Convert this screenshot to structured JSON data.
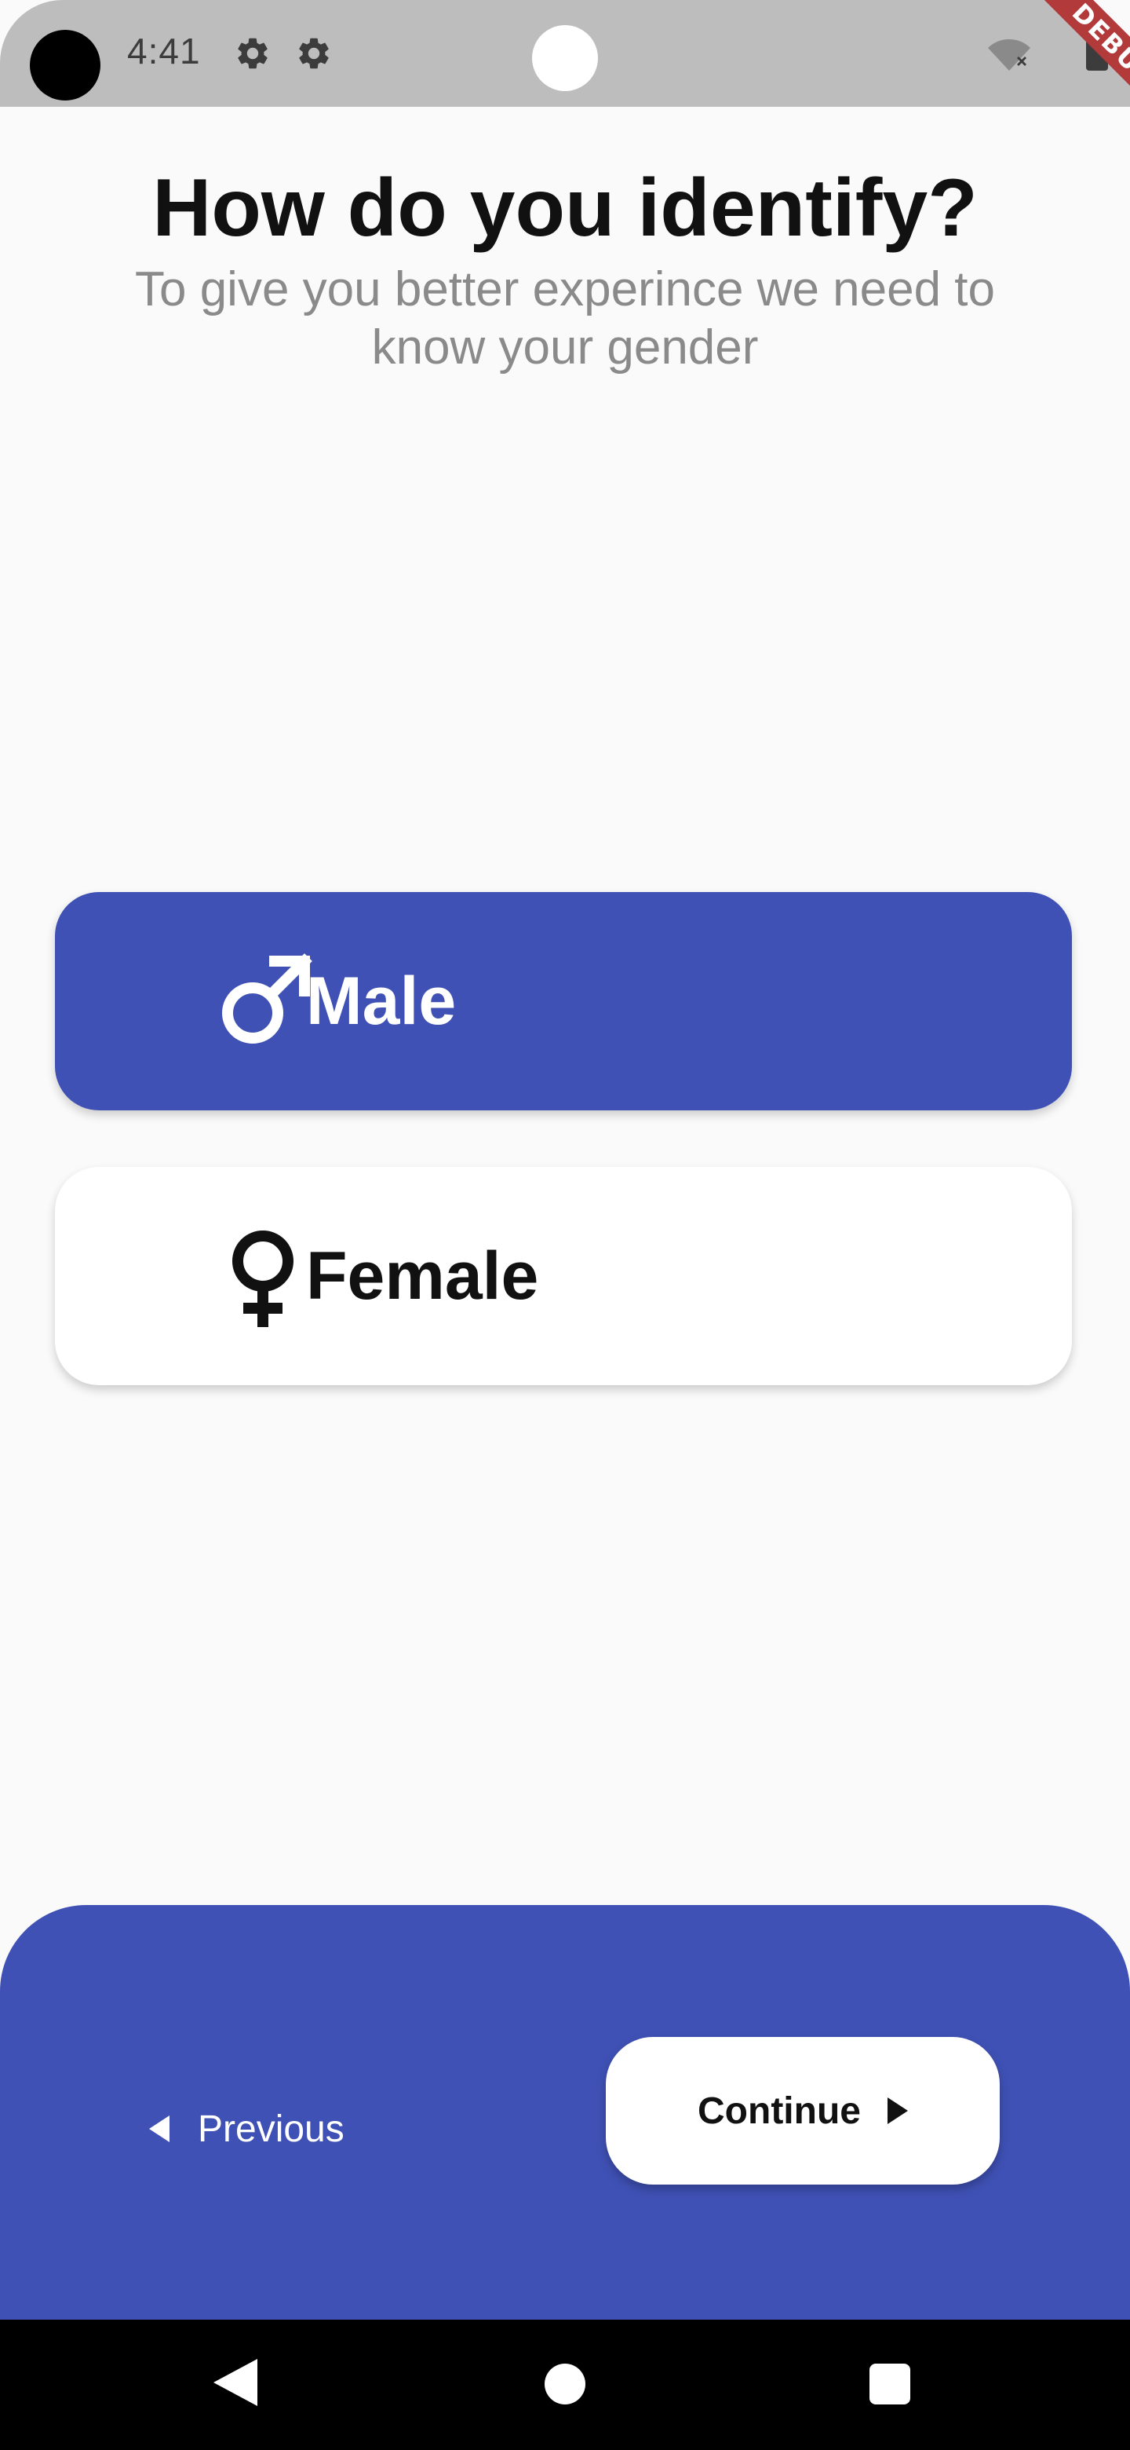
{
  "status_bar": {
    "time": "4:41",
    "icons": [
      "camera-hole",
      "settings-icon",
      "settings-icon",
      "wifi-off-icon",
      "battery-icon"
    ],
    "debug_banner": "DEBUG"
  },
  "header": {
    "title": "How do you identify?",
    "subtitle": "To give you better experince we need to know your gender"
  },
  "options": [
    {
      "label": "Male",
      "icon": "male-icon",
      "selected": true
    },
    {
      "label": "Female",
      "icon": "female-icon",
      "selected": false
    }
  ],
  "footer": {
    "previous_label": "Previous",
    "continue_label": "Continue"
  },
  "colors": {
    "accent": "#3f51b5",
    "background": "#fafafa",
    "status_bar": "#bdbdbd",
    "subtitle": "#8a8a8a",
    "debug_ribbon": "#b33a3a"
  },
  "nav_bar": {
    "icons": [
      "back-icon",
      "home-icon",
      "recents-icon"
    ]
  }
}
